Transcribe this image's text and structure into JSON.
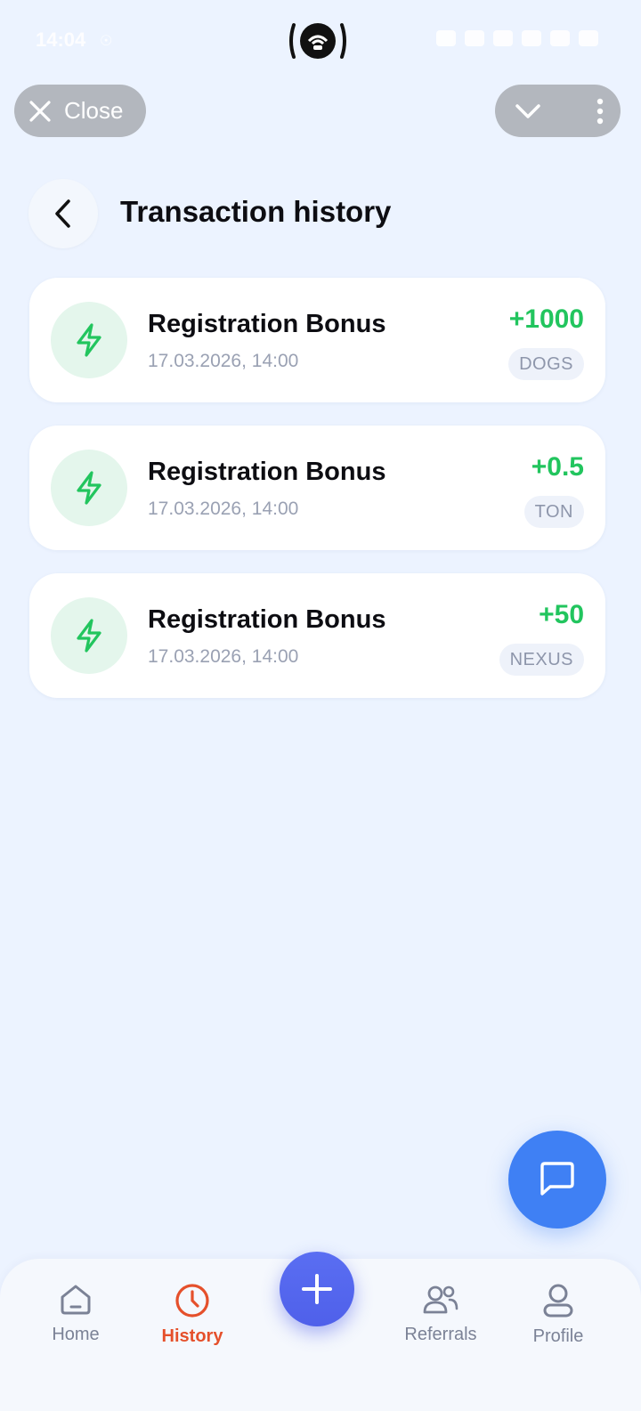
{
  "status_bar": {
    "time": "14:04",
    "key_icon": "key-icon",
    "camera_icon": "camera-cutout-icon"
  },
  "top_bar": {
    "close_label": "Close",
    "close_icon": "close-icon",
    "chevron_icon": "chevron-down-icon",
    "more_icon": "more-vertical-icon"
  },
  "header": {
    "title": "Transaction history",
    "back_icon": "chevron-left-icon"
  },
  "transactions": [
    {
      "title": "Registration Bonus",
      "date": "17.03.2026, 14:00",
      "amount": "+1000",
      "token": "DOGS",
      "icon": "lightning-icon"
    },
    {
      "title": "Registration Bonus",
      "date": "17.03.2026, 14:00",
      "amount": "+0.5",
      "token": "TON",
      "icon": "lightning-icon"
    },
    {
      "title": "Registration Bonus",
      "date": "17.03.2026, 14:00",
      "amount": "+50",
      "token": "NEXUS",
      "icon": "lightning-icon"
    }
  ],
  "chat": {
    "icon": "chat-icon"
  },
  "bottom_nav": {
    "home": {
      "label": "Home",
      "icon": "home-icon"
    },
    "history": {
      "label": "History",
      "icon": "clock-icon",
      "active": true
    },
    "add": {
      "icon": "plus-icon"
    },
    "referrals": {
      "label": "Referrals",
      "icon": "users-icon"
    },
    "profile": {
      "label": "Profile",
      "icon": "user-icon"
    }
  },
  "colors": {
    "background": "#ecf3ff",
    "positive": "#22c55e",
    "active_tab": "#e5502b",
    "chat_fab": "#3f80f4",
    "add_fab": "#5468ee"
  }
}
